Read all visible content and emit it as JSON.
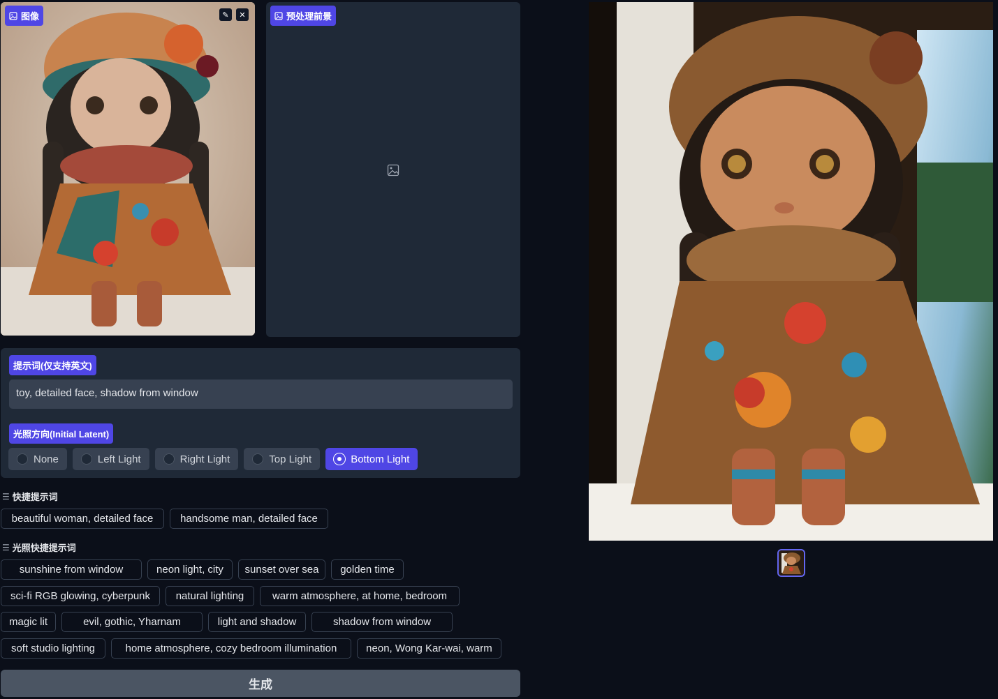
{
  "input_panel": {
    "label": "图像"
  },
  "preproc_panel": {
    "label": "预处理前景"
  },
  "prompt": {
    "label": "提示词(仅支持英文)",
    "value": "toy, detailed face, shadow from window"
  },
  "lighting": {
    "label": "光照方向(Initial Latent)",
    "options": [
      "None",
      "Left Light",
      "Right Light",
      "Top Light",
      "Bottom Light"
    ],
    "selected": "Bottom Light"
  },
  "quick_prompts": {
    "label": "快捷提示词",
    "items": [
      "beautiful woman, detailed face",
      "handsome man, detailed face"
    ]
  },
  "light_prompts": {
    "label": "光照快捷提示词",
    "items": [
      "sunshine from window",
      "neon light, city",
      "sunset over sea",
      "golden time",
      "sci-fi RGB glowing, cyberpunk",
      "natural lighting",
      "warm atmosphere, at home, bedroom",
      "magic lit",
      "evil, gothic, Yharnam",
      "light and shadow",
      "shadow from window",
      "soft studio lighting",
      "home atmosphere, cozy bedroom illumination",
      "neon, Wong Kar-wai, warm"
    ]
  },
  "generate_label": "生成",
  "colors": {
    "accent": "#4f46e5",
    "background": "#0b0f19",
    "panel": "#1f2937"
  }
}
